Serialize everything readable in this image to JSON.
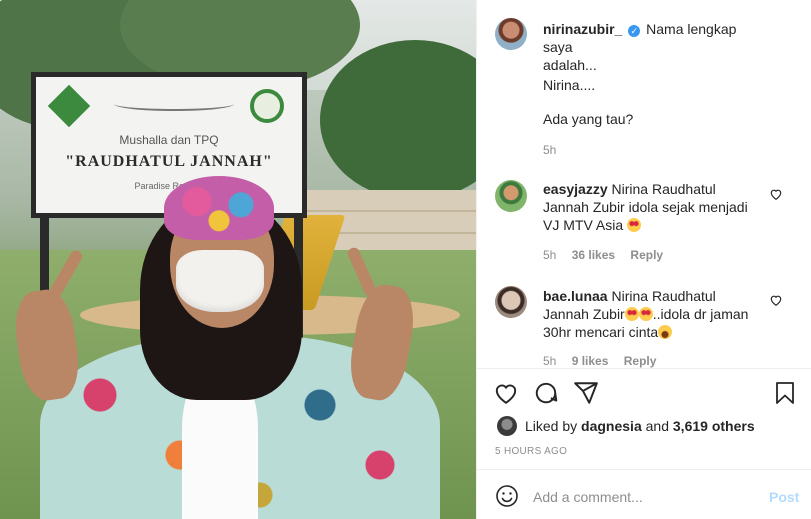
{
  "photo": {
    "sign_subtitle": "Mushalla dan TPQ",
    "sign_title": "\"RAUDHATUL JANNAH\"",
    "sign_footer": "Paradise Resor..."
  },
  "post": {
    "author": "nirinazubir_",
    "verified_glyph": "✓",
    "caption_line1": "Nama lengkap saya",
    "caption_line2": "adalah...",
    "caption_line3": "Nirina....",
    "caption_line4": "Ada yang tau?",
    "time": "5h"
  },
  "comments": [
    {
      "username": "easyjazzy",
      "text": "Nirina Raudhatul Jannah Zubir idola sejak menjadi VJ MTV Asia",
      "time": "5h",
      "likes": "36 likes",
      "reply": "Reply"
    },
    {
      "username": "bae.lunaa",
      "text_a": "Nirina Raudhatul Jannah Zubir",
      "text_b": "..idola dr jaman 30hr mencari cinta",
      "time": "5h",
      "likes": "9 likes",
      "reply": "Reply"
    }
  ],
  "actions": {
    "icons": [
      "heart-icon",
      "comment-icon",
      "share-icon",
      "bookmark-icon"
    ]
  },
  "likes": {
    "prefix": "Liked by",
    "user": "dagnesia",
    "middle": "and",
    "count": "3,619 others"
  },
  "timestamp": "5 HOURS AGO",
  "comment_box": {
    "placeholder": "Add a comment...",
    "post_label": "Post"
  },
  "colors": {
    "verified": "#3897f0",
    "post_disabled": "#b3dbff",
    "muted": "#8e8e8e"
  }
}
